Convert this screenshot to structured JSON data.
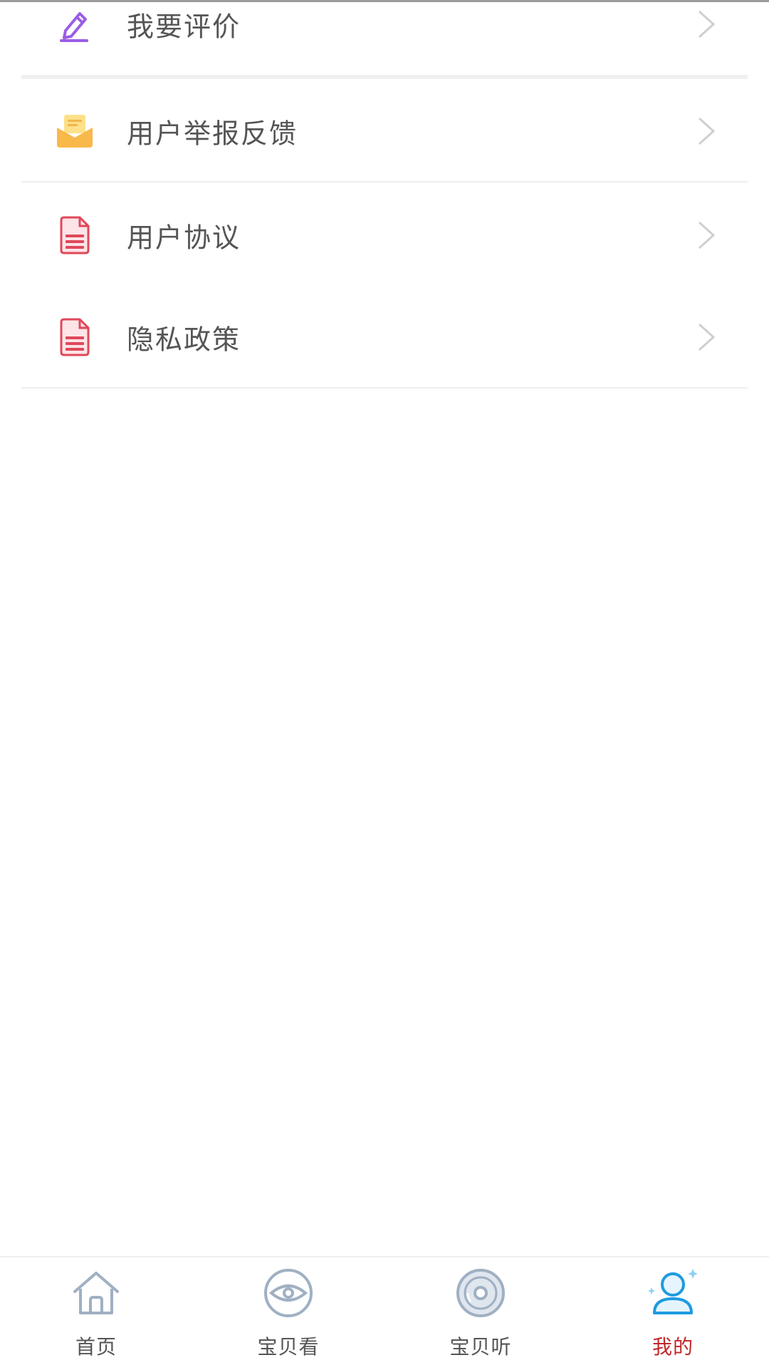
{
  "menu": {
    "items": [
      {
        "label": "我要评价",
        "icon": "pencil-edit-icon"
      },
      {
        "label": "用户举报反馈",
        "icon": "envelope-icon"
      },
      {
        "label": "用户协议",
        "icon": "document-icon"
      },
      {
        "label": "隐私政策",
        "icon": "document-icon"
      }
    ]
  },
  "tabbar": {
    "tabs": [
      {
        "label": "首页",
        "icon": "home-icon",
        "active": false
      },
      {
        "label": "宝贝看",
        "icon": "eye-icon",
        "active": false
      },
      {
        "label": "宝贝听",
        "icon": "disc-icon",
        "active": false
      },
      {
        "label": "我的",
        "icon": "user-icon",
        "active": true
      }
    ]
  },
  "colors": {
    "active_tab": "#c0282a",
    "label_text": "#555555",
    "pencil_icon": "#9b5de5",
    "envelope_icon": "#f9b84a",
    "document_icon": "#e0485a",
    "tab_icon": "#9fb0c2",
    "user_icon_active": "#1e9be0"
  }
}
